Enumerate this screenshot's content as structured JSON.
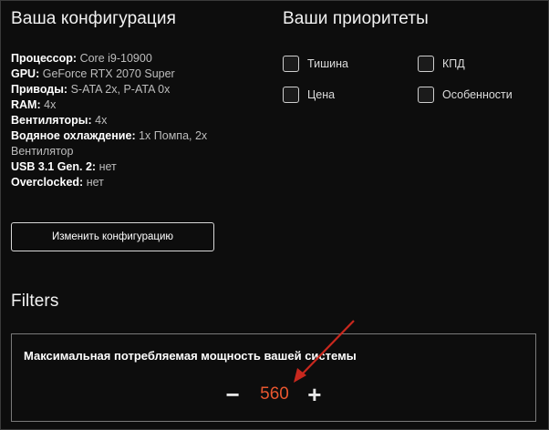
{
  "config": {
    "title": "Ваша конфигурация",
    "specs": [
      {
        "label": "Процессор:",
        "value": "Core i9-10900"
      },
      {
        "label": "GPU:",
        "value": "GeForce RTX 2070 Super"
      },
      {
        "label": "Приводы:",
        "value": "S-ATA 2x, P-ATA 0x"
      },
      {
        "label": "RAM:",
        "value": "4x"
      },
      {
        "label": "Вентиляторы:",
        "value": "4x"
      },
      {
        "label": "Водяное охлаждение:",
        "value": "1x Помпа, 2x Вентилятор"
      },
      {
        "label": "USB 3.1 Gen. 2:",
        "value": "нет"
      },
      {
        "label": "Overclocked:",
        "value": "нет"
      }
    ],
    "change_button": "Изменить конфигурацию"
  },
  "priorities": {
    "title": "Ваши приоритеты",
    "items": [
      {
        "label": "Тишина",
        "checked": false
      },
      {
        "label": "КПД",
        "checked": false
      },
      {
        "label": "Цена",
        "checked": false
      },
      {
        "label": "Особенности",
        "checked": false
      }
    ]
  },
  "filters": {
    "title": "Filters",
    "power_label": "Максимальная потребляемая мощность вашей системы",
    "power_value": "560",
    "minus": "−",
    "plus": "+",
    "value_color": "#e8562f",
    "arrow_color": "#c8281e"
  }
}
